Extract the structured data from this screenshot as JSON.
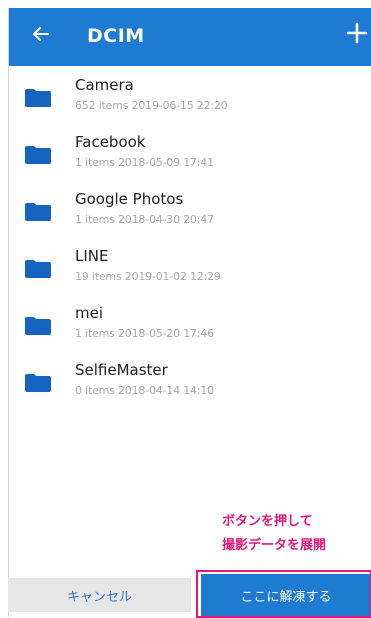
{
  "header": {
    "title": "DCIM",
    "back_icon": "arrow-left-icon",
    "add_icon": "plus-icon",
    "bar_color": "#1e7bd1"
  },
  "folders": [
    {
      "name": "Camera",
      "meta": "652 items 2019-06-15 22:20"
    },
    {
      "name": "Facebook",
      "meta": "1 items 2018-05-09 17:41"
    },
    {
      "name": "Google Photos",
      "meta": "1 items 2018-04-30 20:47"
    },
    {
      "name": "LINE",
      "meta": "19 items 2019-01-02 12:29"
    },
    {
      "name": "mei",
      "meta": "1 items 2018-05-20 17:46"
    },
    {
      "name": "SelfieMaster",
      "meta": "0 items 2018-04-14 14:10"
    }
  ],
  "annotation": {
    "line1": "ボタンを押して",
    "line2": "撮影データを展開",
    "color": "#e0197a"
  },
  "footer": {
    "cancel_label": "キャンセル",
    "confirm_label": "ここに解凍する"
  }
}
